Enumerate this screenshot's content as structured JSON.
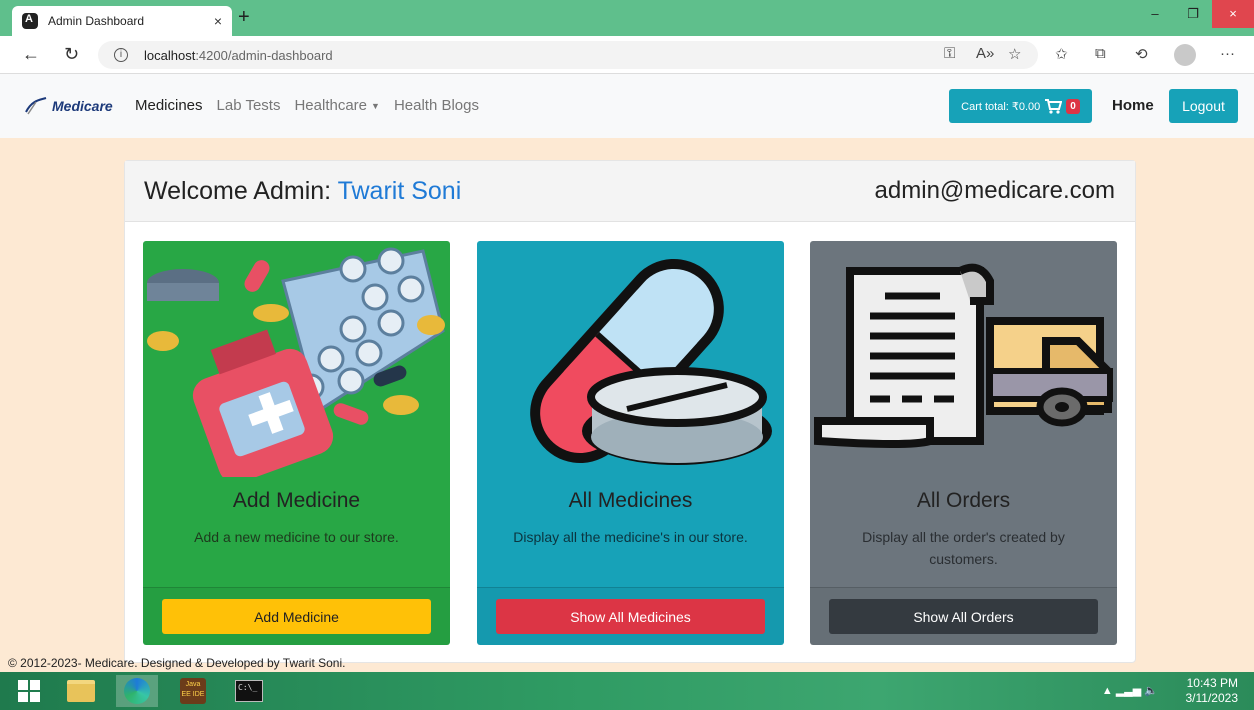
{
  "browser": {
    "tab_title": "Admin Dashboard",
    "tab_close": "×",
    "new_tab": "+",
    "window_controls": {
      "minimize": "–",
      "restore": "❐",
      "close": "×"
    },
    "url_host": "localhost",
    "url_rest": ":4200/admin-dashboard"
  },
  "navbar": {
    "brand": "Medicare",
    "links": [
      "Medicines",
      "Lab Tests",
      "Healthcare",
      "Health Blogs"
    ],
    "cart_label": "Cart total: ₹0.00",
    "cart_count": "0",
    "home": "Home",
    "logout": "Logout"
  },
  "dashboard": {
    "welcome_prefix": "Welcome Admin: ",
    "admin_name": "Twarit Soni",
    "admin_email": "admin@medicare.com",
    "cards": [
      {
        "title": "Add Medicine",
        "description": "Add a new medicine to our store.",
        "button": "Add Medicine"
      },
      {
        "title": "All Medicines",
        "description": "Display all the medicine's in our store.",
        "button": "Show All Medicines"
      },
      {
        "title": "All Orders",
        "description": "Display all the order's created by customers.",
        "button": "Show All Orders"
      }
    ]
  },
  "footer": "© 2012-2023- Medicare. Designed & Developed by Twarit Soni.",
  "taskbar": {
    "time": "10:43 PM",
    "date": "3/11/2023",
    "jee_label": "Java EE IDE",
    "cmd_label": "C:\\_"
  },
  "colors": {
    "success": "#28a745",
    "info": "#17a2b8",
    "secondary": "#6c757d",
    "warning": "#ffc107",
    "danger": "#dc3545",
    "dark": "#343a40",
    "page_bg": "#fde9d3"
  }
}
